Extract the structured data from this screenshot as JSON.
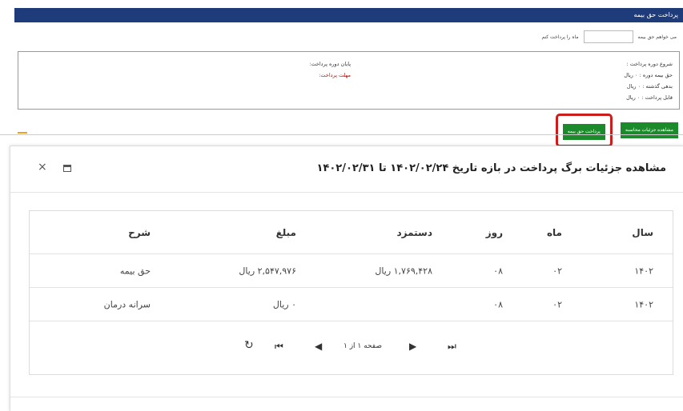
{
  "top_panel": {
    "title": "پرداخت حق بیمه",
    "pay_label_before": "می خواهم حق بیمه",
    "pay_label_after": "ماه را پرداخت کنم",
    "months_value": "",
    "info": {
      "period_start": "شروع دوره پرداخت :",
      "period_end": "پایان دوره پرداخت:",
      "period_premium": "حق بیمه دوره : ۰ ریال",
      "due_date": "مهلت پرداخت:",
      "past_debt": "بدهی گذشته : ۰ ریال",
      "payable": "قابل پرداخت : ۰ ریال"
    },
    "buttons": {
      "details": "مشاهده جزئیات محاسبه",
      "pay": "پرداخت حق بیمه"
    },
    "colors": {
      "bar": "#1f3c7a",
      "button": "#1b8a2a",
      "highlight": "#cc1d1d",
      "due": "#cc0000"
    }
  },
  "modal": {
    "title": "مشاهده جزئیات برگ پرداخت در بازه تاریخ ۱۴۰۲/۰۲/۲۴ تا ۱۴۰۲/۰۲/۳۱",
    "close_symbol": "×",
    "table": {
      "headers": [
        "سال",
        "ماه",
        "روز",
        "دستمزد",
        "مبلغ",
        "شرح"
      ],
      "rows": [
        [
          "۱۴۰۲",
          "۰۲",
          "۰۸",
          "۱,۷۶۹,۴۲۸ ریال",
          "۲,۵۴۷,۹۷۶ ریال",
          "حق بیمه"
        ],
        [
          "۱۴۰۲",
          "۰۲",
          "۰۸",
          "",
          "۰ ریال",
          "سرانه درمان"
        ]
      ]
    },
    "pager": {
      "page_text": "صفحه ۱ از ۱",
      "refresh": "↻",
      "first": "⏮",
      "prev": "◀",
      "next": "▶",
      "last": "⏭"
    }
  }
}
